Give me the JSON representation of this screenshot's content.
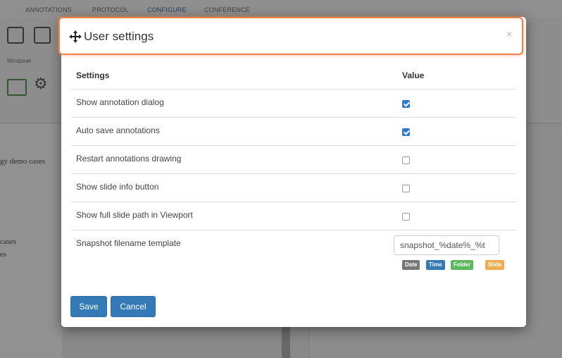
{
  "background": {
    "tabs": [
      "ANNOTATIONS",
      "PROTOCOL",
      "CONFIGURE",
      "CONFERENCE"
    ],
    "toolbar_caption": "Mindpeak",
    "sidebar_texts": [
      "gy demo cases",
      "cases",
      "es"
    ]
  },
  "modal": {
    "title": "User settings",
    "close_label": "×",
    "table": {
      "headers": {
        "settings": "Settings",
        "value": "Value"
      },
      "rows": [
        {
          "label": "Show annotation dialog",
          "checked": true
        },
        {
          "label": "Auto save annotations",
          "checked": true
        },
        {
          "label": "Restart annotations drawing",
          "checked": false
        },
        {
          "label": "Show slide info button",
          "checked": false
        },
        {
          "label": "Show full slide path in Viewport",
          "checked": false
        }
      ],
      "snapshot": {
        "label": "Snapshot filename template",
        "value": "snapshot_%date%_%t",
        "tags": [
          "Date",
          "Time",
          "Folder",
          "Slide"
        ]
      }
    },
    "buttons": {
      "save": "Save",
      "cancel": "Cancel"
    }
  },
  "colors": {
    "header_highlight": "#f0824a",
    "primary_button": "#337ab7",
    "checkbox_checked": "#2d78d1",
    "tag_date": "#777777",
    "tag_time": "#337ab7",
    "tag_folder": "#5cb85c",
    "tag_slide": "#f0ad4e"
  }
}
